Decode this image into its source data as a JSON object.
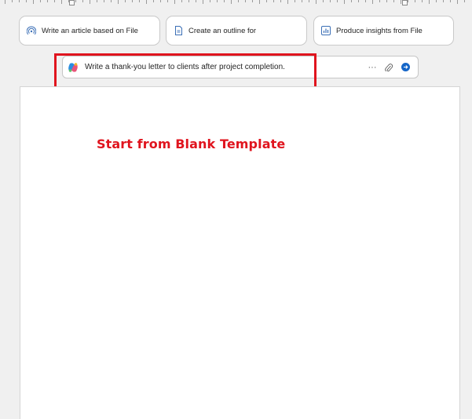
{
  "suggestions": [
    {
      "label": "Write an article based on File",
      "icon": "broadcast-icon"
    },
    {
      "label": "Create an outline for",
      "icon": "document-icon"
    },
    {
      "label": "Produce insights from File",
      "icon": "chart-icon"
    }
  ],
  "prompt": {
    "text": "Write a thank-you letter to clients after project completion.",
    "more_glyph": "···",
    "icons": [
      "copilot-logo-icon",
      "more-icon",
      "attach-icon",
      "send-icon"
    ]
  },
  "annotation": {
    "text": "Start from Blank Template",
    "color": "#e0141e"
  },
  "colors": {
    "accent": "#1566c8",
    "highlight": "#e0141e"
  }
}
